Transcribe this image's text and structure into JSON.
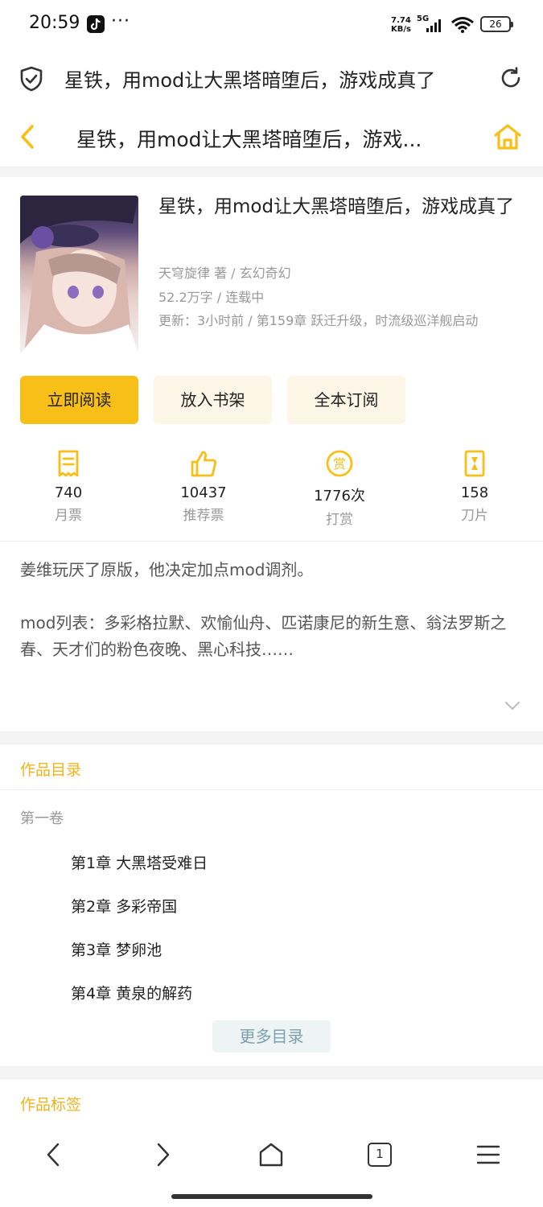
{
  "status": {
    "time": "20:59",
    "more_dots": "···",
    "net_speed_value": "7.74",
    "net_speed_unit": "KB/s",
    "network": "5G",
    "battery": "26"
  },
  "browser": {
    "url_text": "星铁，用mod让大黑塔暗堕后，游戏成真了",
    "shield_icon": "shield-check-icon",
    "reload_icon": "reload-icon"
  },
  "nav": {
    "title": "星铁，用mod让大黑塔暗堕后，游戏...",
    "accent": "#f8bf18"
  },
  "book": {
    "title": "星铁，用mod让大黑塔暗堕后，游戏成真了",
    "author_genre": "天穹旋律 著 / 玄幻奇幻",
    "words_status": "52.2万字 / 连载中",
    "update": "更新：3小时前 / 第159章 跃迁升级，时流级巡洋舰启动"
  },
  "actions": {
    "read": "立即阅读",
    "shelf": "放入书架",
    "subscribe": "全本订阅"
  },
  "stats": [
    {
      "value": "740",
      "label": "月票",
      "icon": "monthly-ticket-icon"
    },
    {
      "value": "10437",
      "label": "推荐票",
      "icon": "thumbs-up-icon"
    },
    {
      "value": "1776次",
      "label": "打赏",
      "icon": "reward-coin-icon"
    },
    {
      "value": "158",
      "label": "刀片",
      "icon": "blade-icon"
    }
  ],
  "intro": {
    "p1": "姜维玩厌了原版，他决定加点mod调剂。",
    "p2": "mod列表：多彩格拉默、欢愉仙舟、匹诺康尼的新生意、翁法罗斯之春、天才们的粉色夜晚、黑心科技……"
  },
  "catalog": {
    "title": "作品目录",
    "volume": "第一卷",
    "chapters": [
      "第1章 大黑塔受难日",
      "第2章 多彩帝国",
      "第3章 梦卵池",
      "第4章 黄泉的解药"
    ],
    "more": "更多目录"
  },
  "tags": {
    "title": "作品标签"
  },
  "bottom_nav": {
    "tab_count": "1"
  }
}
